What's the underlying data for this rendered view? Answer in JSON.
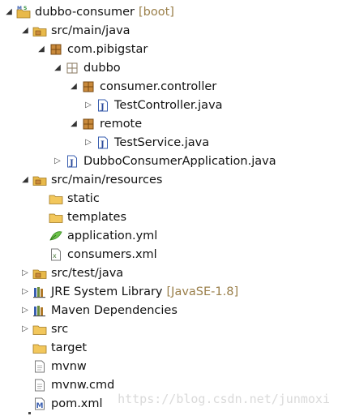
{
  "tree": {
    "project": {
      "label": "dubbo-consumer",
      "decoration": "[boot]"
    },
    "src_main_java": {
      "label": "src/main/java"
    },
    "pkg_com_pibigstar": {
      "label": "com.pibigstar"
    },
    "pkg_dubbo": {
      "label": "dubbo"
    },
    "pkg_consumer_controller": {
      "label": "consumer.controller"
    },
    "test_controller": {
      "label": "TestController.java"
    },
    "pkg_remote": {
      "label": "remote"
    },
    "test_service": {
      "label": "TestService.java"
    },
    "dubbo_consumer_app": {
      "label": "DubboConsumerApplication.java"
    },
    "src_main_resources": {
      "label": "src/main/resources"
    },
    "static_folder": {
      "label": "static"
    },
    "templates_folder": {
      "label": "templates"
    },
    "application_yml": {
      "label": "application.yml"
    },
    "consumers_xml": {
      "label": "consumers.xml"
    },
    "src_test_java": {
      "label": "src/test/java"
    },
    "jre_library": {
      "label": "JRE System Library",
      "decoration": "[JavaSE-1.8]"
    },
    "maven_dependencies": {
      "label": "Maven Dependencies"
    },
    "src_folder": {
      "label": "src"
    },
    "target_folder": {
      "label": "target"
    },
    "mvnw": {
      "label": "mvnw"
    },
    "mvnw_cmd": {
      "label": "mvnw.cmd"
    },
    "pom_xml": {
      "label": "pom.xml"
    }
  },
  "watermark": "https://blog.csdn.net/junmoxi",
  "icons": {
    "expanded": "expanded-arrow-icon",
    "collapsed": "collapsed-arrow-icon",
    "project": "maven-project-icon",
    "source-folder": "source-folder-icon",
    "package": "package-icon",
    "empty-package": "empty-package-icon",
    "java": "java-file-icon",
    "folder": "folder-icon",
    "yml": "yml-file-icon",
    "xml": "xml-file-icon",
    "library": "library-icon",
    "file": "file-icon",
    "pom": "maven-pom-icon"
  },
  "colors": {
    "decoration": "#9a7f4a",
    "folder": "#e8b94a",
    "package": "#b07a2a"
  }
}
